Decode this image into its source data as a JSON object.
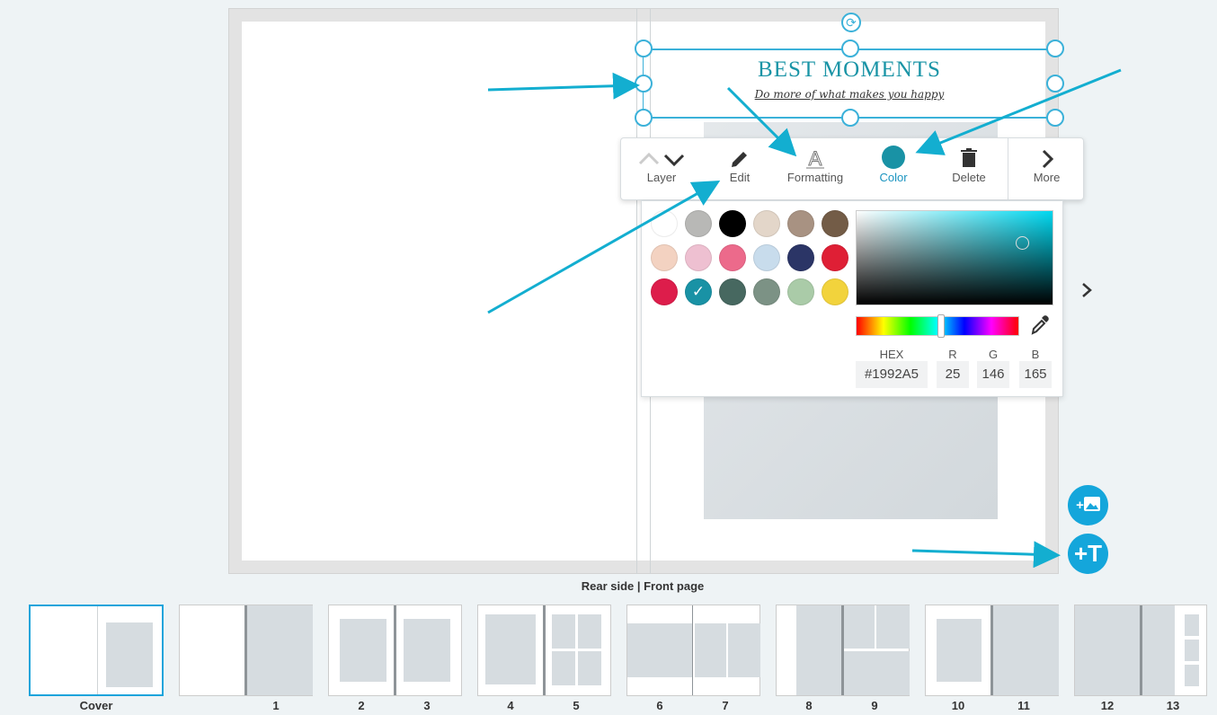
{
  "canvas": {
    "title": "BEST MOMENTS",
    "subtitle": "Do more of what makes you happy",
    "caption": "Rear side | Front page"
  },
  "toolbar": {
    "layer_label": "Layer",
    "edit_label": "Edit",
    "formatting_label": "Formatting",
    "color_label": "Color",
    "delete_label": "Delete",
    "more_label": "More",
    "layer_up_icon": "chevron-up-icon",
    "layer_down_icon": "chevron-down-icon",
    "edit_icon": "pencil-icon",
    "formatting_icon": "text-format-icon",
    "delete_icon": "trash-icon",
    "more_icon": "chevron-right-icon"
  },
  "color_panel": {
    "swatches": [
      "#ffffff",
      "#b8b8b6",
      "#000000",
      "#e3d6c9",
      "#a89282",
      "#735c47",
      "#f3d2c1",
      "#eec0d1",
      "#ec6a8b",
      "#c8dcec",
      "#2b3566",
      "#df1f35",
      "#dd1d4b",
      "#1992a5",
      "#476860",
      "#7c9285",
      "#aacba8",
      "#f2d33c"
    ],
    "selected_color": "#1992a5",
    "hex_label": "HEX",
    "r_label": "R",
    "g_label": "G",
    "b_label": "B",
    "hex_value": "#1992A5",
    "r_value": "25",
    "g_value": "146",
    "b_value": "165",
    "eyedropper_icon": "eyedropper-icon"
  },
  "actions": {
    "add_image_label": "+",
    "add_text_label": "+T"
  },
  "thumbnails": [
    {
      "label": "Cover"
    },
    {
      "label": "1"
    },
    {
      "label": "2"
    },
    {
      "label": "3"
    },
    {
      "label": "4"
    },
    {
      "label": "5"
    },
    {
      "label": "6"
    },
    {
      "label": "7"
    },
    {
      "label": "8"
    },
    {
      "label": "9"
    },
    {
      "label": "10"
    },
    {
      "label": "11"
    },
    {
      "label": "12"
    },
    {
      "label": "13"
    }
  ],
  "colors": {
    "accent": "#14a6db",
    "title": "#1a94a6",
    "selection": "#3bb1d9"
  }
}
